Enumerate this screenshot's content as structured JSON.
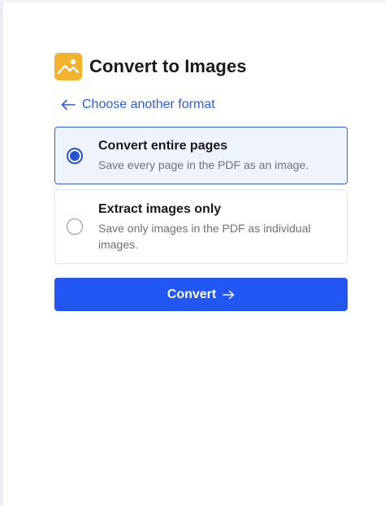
{
  "header": {
    "title": "Convert to Images",
    "icon": "image-icon",
    "icon_color": "#f2b22d"
  },
  "back_link": {
    "label": "Choose another format",
    "icon": "arrow-left-icon"
  },
  "options": [
    {
      "title": "Convert entire pages",
      "description": "Save every page in the PDF as an image.",
      "selected": true
    },
    {
      "title": "Extract images only",
      "description": "Save only images in the PDF as individual images.",
      "selected": false
    }
  ],
  "convert_button": {
    "label": "Convert",
    "icon": "arrow-right-icon",
    "color": "#2156f2"
  },
  "colors": {
    "accent": "#2452d6",
    "link": "#2a5de0",
    "selected_bg": "#eef3fe"
  }
}
